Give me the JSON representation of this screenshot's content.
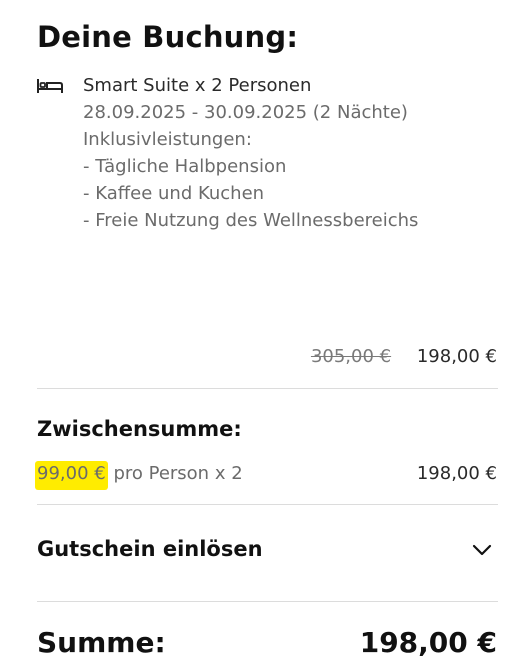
{
  "booking": {
    "title": "Deine Buchung:",
    "icon": "bed-icon",
    "room_name": "Smart Suite x 2 Personen",
    "dates": "28.09.2025 - 30.09.2025 (2 Nächte)",
    "inclusions_heading": "Inklusivleistungen:",
    "inclusions": [
      "- Tägliche Halbpension",
      "- Kaffee und Kuchen",
      "- Freie Nutzung des Wellnessbereichs"
    ],
    "old_price": "305,00 €",
    "price": "198,00 €"
  },
  "subtotal": {
    "heading": "Zwischensumme:",
    "per_person_amount": "99,00 €",
    "per_person_text": " pro Person x 2",
    "value": "198,00 €",
    "highlight_color": "#ffec00"
  },
  "voucher": {
    "label": "Gutschein einlösen",
    "icon": "chevron-down-icon"
  },
  "total": {
    "label": "Summe:",
    "value": "198,00 €"
  }
}
